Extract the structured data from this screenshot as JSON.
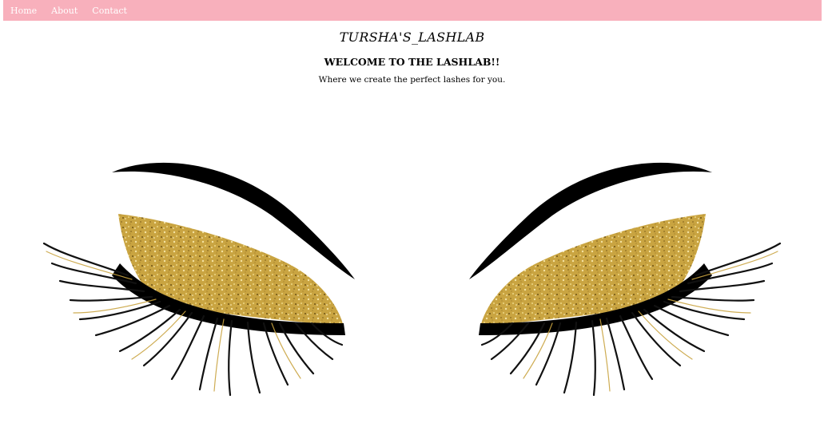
{
  "nav": {
    "items": [
      {
        "label": "Home"
      },
      {
        "label": "About"
      },
      {
        "label": "Contact"
      }
    ],
    "background_color": "#f8b0bc",
    "text_color": "#ffffff"
  },
  "header": {
    "brand": "TURSHA'S_LASHLAB",
    "welcome": "WELCOME TO THE LASHLAB!!",
    "tagline": "Where we create the perfect lashes for you."
  },
  "hero": {
    "image": "glitter-eyelash-illustration",
    "glitter_color": "#c9a441"
  }
}
